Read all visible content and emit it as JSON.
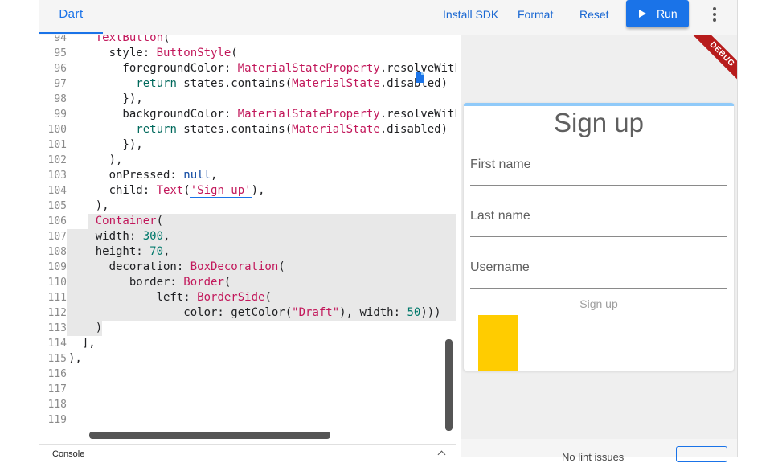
{
  "toolbar": {
    "tab_label": "Dart",
    "install_sdk": "Install SDK",
    "format": "Format",
    "reset": "Reset",
    "run": "Run"
  },
  "editor": {
    "line_numbers": [
      "94",
      "95",
      "96",
      "97",
      "98",
      "99",
      "100",
      "101",
      "102",
      "103",
      "104",
      "105",
      "106",
      "107",
      "108",
      "109",
      "110",
      "111",
      "112",
      "113",
      "114",
      "115",
      "116",
      "117",
      "118",
      "119"
    ]
  },
  "console": {
    "title": "Console"
  },
  "preview": {
    "debug_banner": "DEBUG",
    "form_title": "Sign up",
    "fields": [
      "First name",
      "Last name",
      "Username"
    ],
    "signup_button": "Sign up",
    "bottom_text": "No lint issues"
  },
  "colors": {
    "accent": "#1a73e8",
    "debug": "#b71c1c",
    "draft": "#ffcc00",
    "progress": "#90caf9"
  }
}
